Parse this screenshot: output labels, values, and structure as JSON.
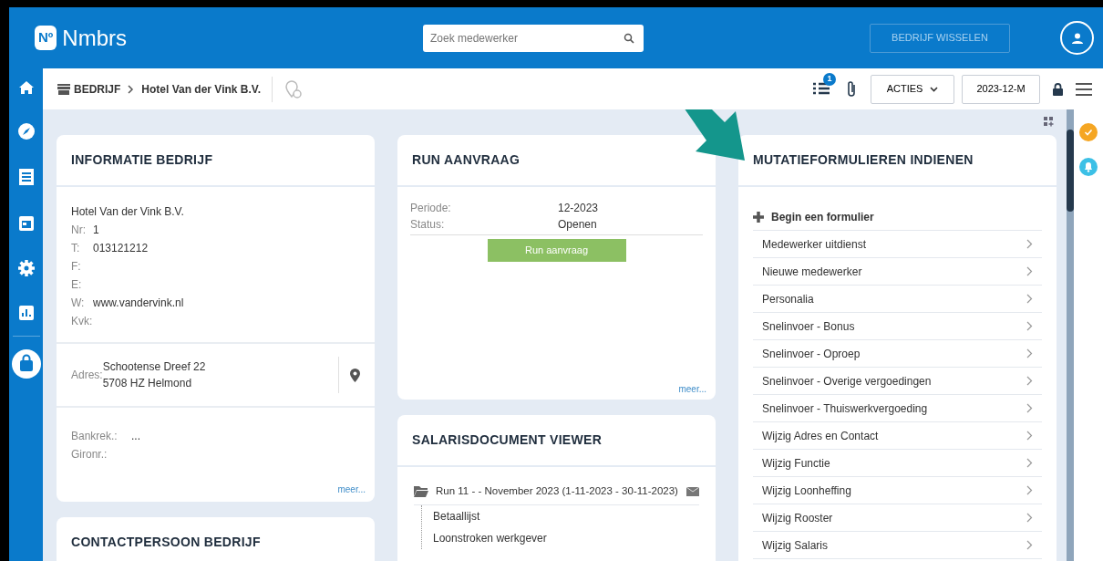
{
  "app": {
    "logo_mark": "Nº",
    "logo_text": "Nmbrs"
  },
  "search": {
    "placeholder": "Zoek medewerker"
  },
  "switch_button": {
    "label": "BEDRIJF WISSELEN",
    "disabled": true
  },
  "breadcrumb": [
    {
      "text": "BEDRIJF"
    },
    {
      "text": "Hotel Van der Vink B.V."
    }
  ],
  "toolbar": {
    "badge": "1",
    "actions": "ACTIES",
    "period": "2023-12-M"
  },
  "info_card": {
    "title": "INFORMATIE BEDRIJF",
    "company": "Hotel Van der Vink B.V.",
    "fields": [
      {
        "label": "Nr:",
        "value": "1"
      },
      {
        "label": "T:",
        "value": "013121212"
      },
      {
        "label": "F:"
      },
      {
        "label": "E:"
      },
      {
        "label": "W:",
        "value": "www.vandervink.nl"
      },
      {
        "label": "Kvk:"
      }
    ],
    "address": {
      "label": "Adres:",
      "lines": [
        "Schootense Dreef 22",
        "5708 HZ Helmond"
      ]
    },
    "bank": [
      {
        "label": "Bankrek.:",
        "value": "..."
      },
      {
        "label": "Gironr.:"
      }
    ],
    "more": "meer..."
  },
  "contact_card": {
    "title": "CONTACTPERSOON BEDRIJF"
  },
  "run_card": {
    "title": "RUN AANVRAAG",
    "rows": [
      {
        "label": "Periode:",
        "value": "12-2023"
      },
      {
        "label": "Status:",
        "value": "Openen"
      }
    ],
    "button": "Run aanvraag",
    "more": "meer..."
  },
  "salaris_card": {
    "title": "SALARISDOCUMENT VIEWER",
    "folder": {
      "label": "Run 11 - - November 2023 (1-11-2023 - 30-11-2023)",
      "children": [
        {
          "label": "Betaallijst"
        },
        {
          "label": "Loonstroken werkgever"
        }
      ]
    }
  },
  "mutatie_card": {
    "title": "MUTATIEFORMULIEREN INDIENEN",
    "start": "Begin een formulier",
    "items": [
      "Medewerker uitdienst",
      "Nieuwe medewerker",
      "Personalia",
      "Snelinvoer - Bonus",
      "Snelinvoer - Oproep",
      "Snelinvoer - Overige vergoedingen",
      "Snelinvoer - Thuiswerkvergoeding",
      "Wijzig Adres en Contact",
      "Wijzig Functie",
      "Wijzig Loonheffing",
      "Wijzig Rooster",
      "Wijzig Salaris"
    ]
  }
}
